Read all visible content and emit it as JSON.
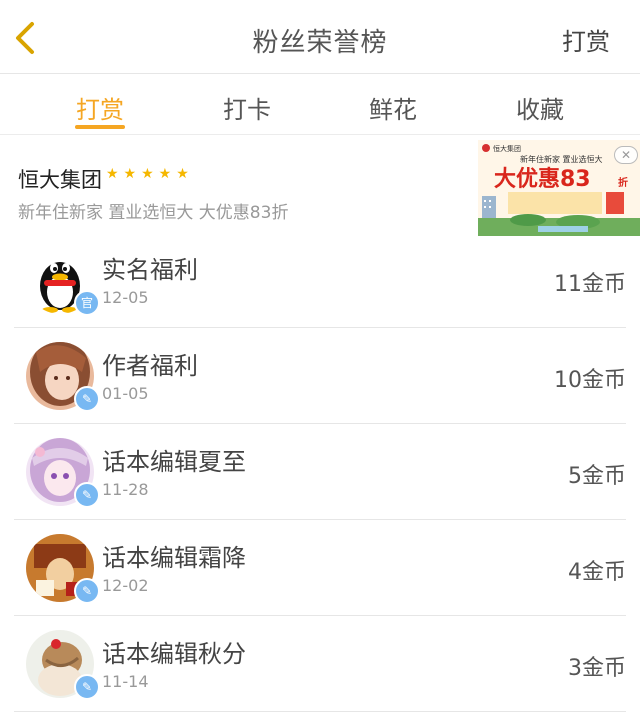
{
  "header": {
    "title": "粉丝荣誉榜",
    "right_action": "打赏",
    "back_icon": "chevron-left-icon",
    "accent": "#f5a623"
  },
  "tabs": [
    {
      "label": "打赏",
      "active": true
    },
    {
      "label": "打卡",
      "active": false
    },
    {
      "label": "鲜花",
      "active": false
    },
    {
      "label": "收藏",
      "active": false
    }
  ],
  "ad": {
    "brand": "恒大集团",
    "stars": "★★★★★",
    "slogan": "新年住新家 置业选恒大 大优惠83折",
    "image": {
      "logo": "恒大集团",
      "top_text": "新年住新家  置业选恒大",
      "headline": "大优惠83",
      "headline_suffix": "折"
    },
    "close_icon": "close-icon"
  },
  "list": [
    {
      "name": "实名福利",
      "date": "12-05",
      "amount": "11金币",
      "badge": "官",
      "avatar": "penguin-avatar"
    },
    {
      "name": "作者福利",
      "date": "01-05",
      "amount": "10金币",
      "badge": "",
      "avatar": "anime-girl-avatar"
    },
    {
      "name": "话本编辑夏至",
      "date": "11-28",
      "amount": "5金币",
      "badge": "",
      "avatar": "anime-purple-avatar"
    },
    {
      "name": "话本编辑霜降",
      "date": "12-02",
      "amount": "4金币",
      "badge": "",
      "avatar": "vintage-avatar"
    },
    {
      "name": "话本编辑秋分",
      "date": "11-14",
      "amount": "3金币",
      "badge": "",
      "avatar": "hair-bun-avatar"
    }
  ]
}
